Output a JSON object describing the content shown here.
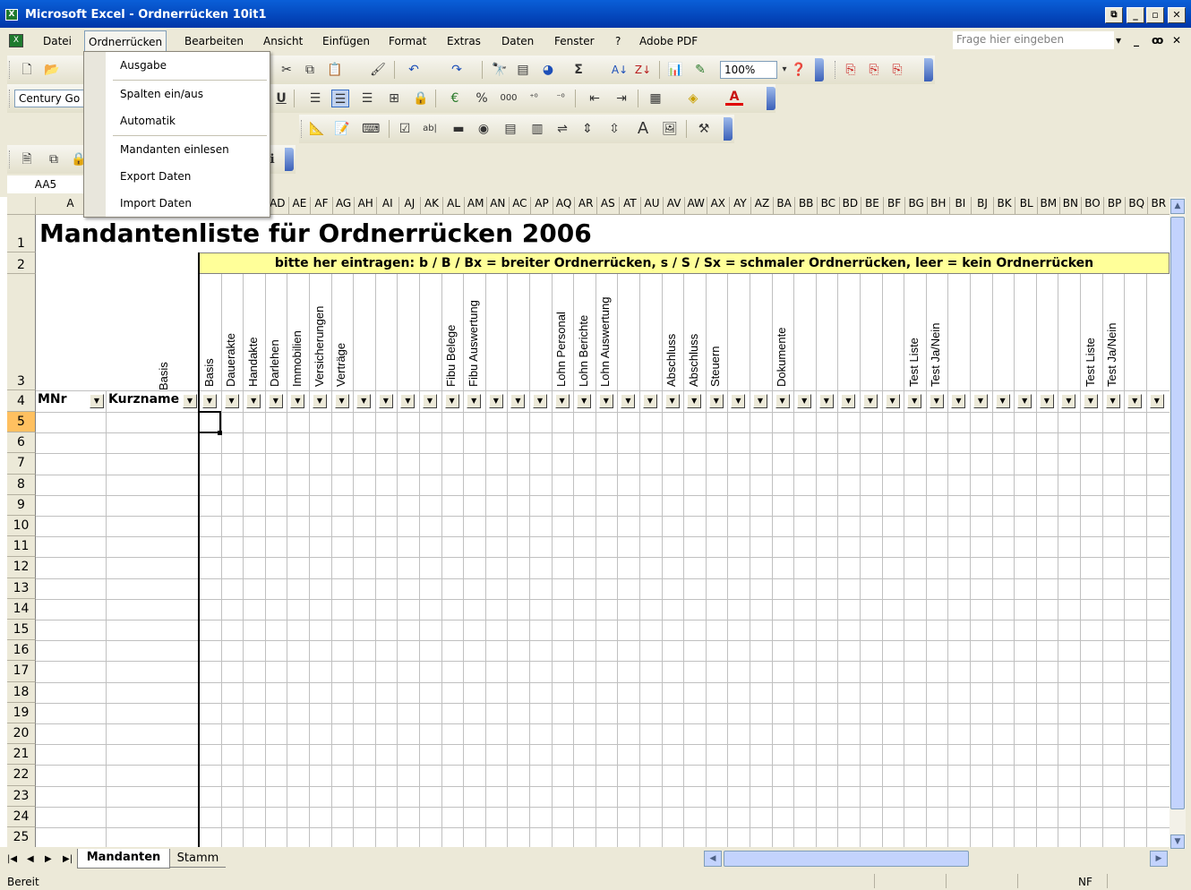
{
  "window": {
    "title": "Microsoft Excel - Ordnerrücken 10it1"
  },
  "menu": {
    "items": [
      "Datei",
      "Ordnerrücken",
      "Bearbeiten",
      "Ansicht",
      "Einfügen",
      "Format",
      "Extras",
      "Daten",
      "Fenster",
      "?",
      "Adobe PDF"
    ],
    "active": "Ordnerrücken",
    "help_placeholder": "Frage hier eingeben"
  },
  "dropdown": {
    "items": [
      "Ausgabe",
      "Spalten ein/aus",
      "Automatik",
      "Mandanten einlesen",
      "Export Daten",
      "Import Daten"
    ]
  },
  "toolbar": {
    "font_name": "Century Go",
    "zoom": "100%"
  },
  "formula": {
    "name_box": "AA5"
  },
  "sheet": {
    "column_headers": [
      "A",
      "AD",
      "AE",
      "AF",
      "AG",
      "AH",
      "AI",
      "AJ",
      "AK",
      "AL",
      "AM",
      "AN",
      "AC",
      "AP",
      "AQ",
      "AR",
      "AS",
      "AT",
      "AU",
      "AV",
      "AW",
      "AX",
      "AY",
      "AZ",
      "BA",
      "BB",
      "BC",
      "BD",
      "BE",
      "BF",
      "BG",
      "BH",
      "BI",
      "BJ",
      "BK",
      "BL",
      "BM",
      "BN",
      "BO",
      "BP",
      "BQ",
      "BR"
    ],
    "title": "Mandantenliste für Ordnerrücken 2006",
    "instruction": "bitte her eintragen: b / B / Bx = breiter Ordnerrücken, s / S / Sx = schmaler Ordnerrücken, leer = kein Ordnerrücken",
    "row_numbers": [
      "1",
      "2",
      "3",
      "4",
      "5",
      "6",
      "7",
      "8",
      "9",
      "10",
      "11",
      "12",
      "13",
      "14",
      "15",
      "16",
      "17",
      "18",
      "19",
      "20",
      "21",
      "22",
      "23",
      "24",
      "25"
    ],
    "basis_label": "Basis",
    "col_labels": [
      "Basis",
      "Dauerakte",
      "Handakte",
      "Darlehen",
      "Immobilien",
      "Versicherungen",
      "Verträge",
      "",
      "",
      "",
      "",
      "Fibu Belege",
      "Fibu Auswertung",
      "",
      "",
      "",
      "Lohn Personal",
      "Lohn Berichte",
      "Lohn Auswertung",
      "",
      "",
      "Abschluss",
      "Abschluss",
      "Steuern",
      "",
      "",
      "Dokumente",
      "",
      "",
      "",
      "",
      "",
      "Test Liste",
      "Test Ja/Nein",
      "",
      "",
      "",
      "",
      "",
      "",
      "Test Liste",
      "Test Ja/Nein",
      "",
      ""
    ],
    "header_mnr": "MNr",
    "header_kurzname": "Kurzname"
  },
  "tabs": {
    "items": [
      "Mandanten",
      "Stamm"
    ],
    "active": "Mandanten"
  },
  "status": {
    "left": "Bereit",
    "right": "NF"
  }
}
